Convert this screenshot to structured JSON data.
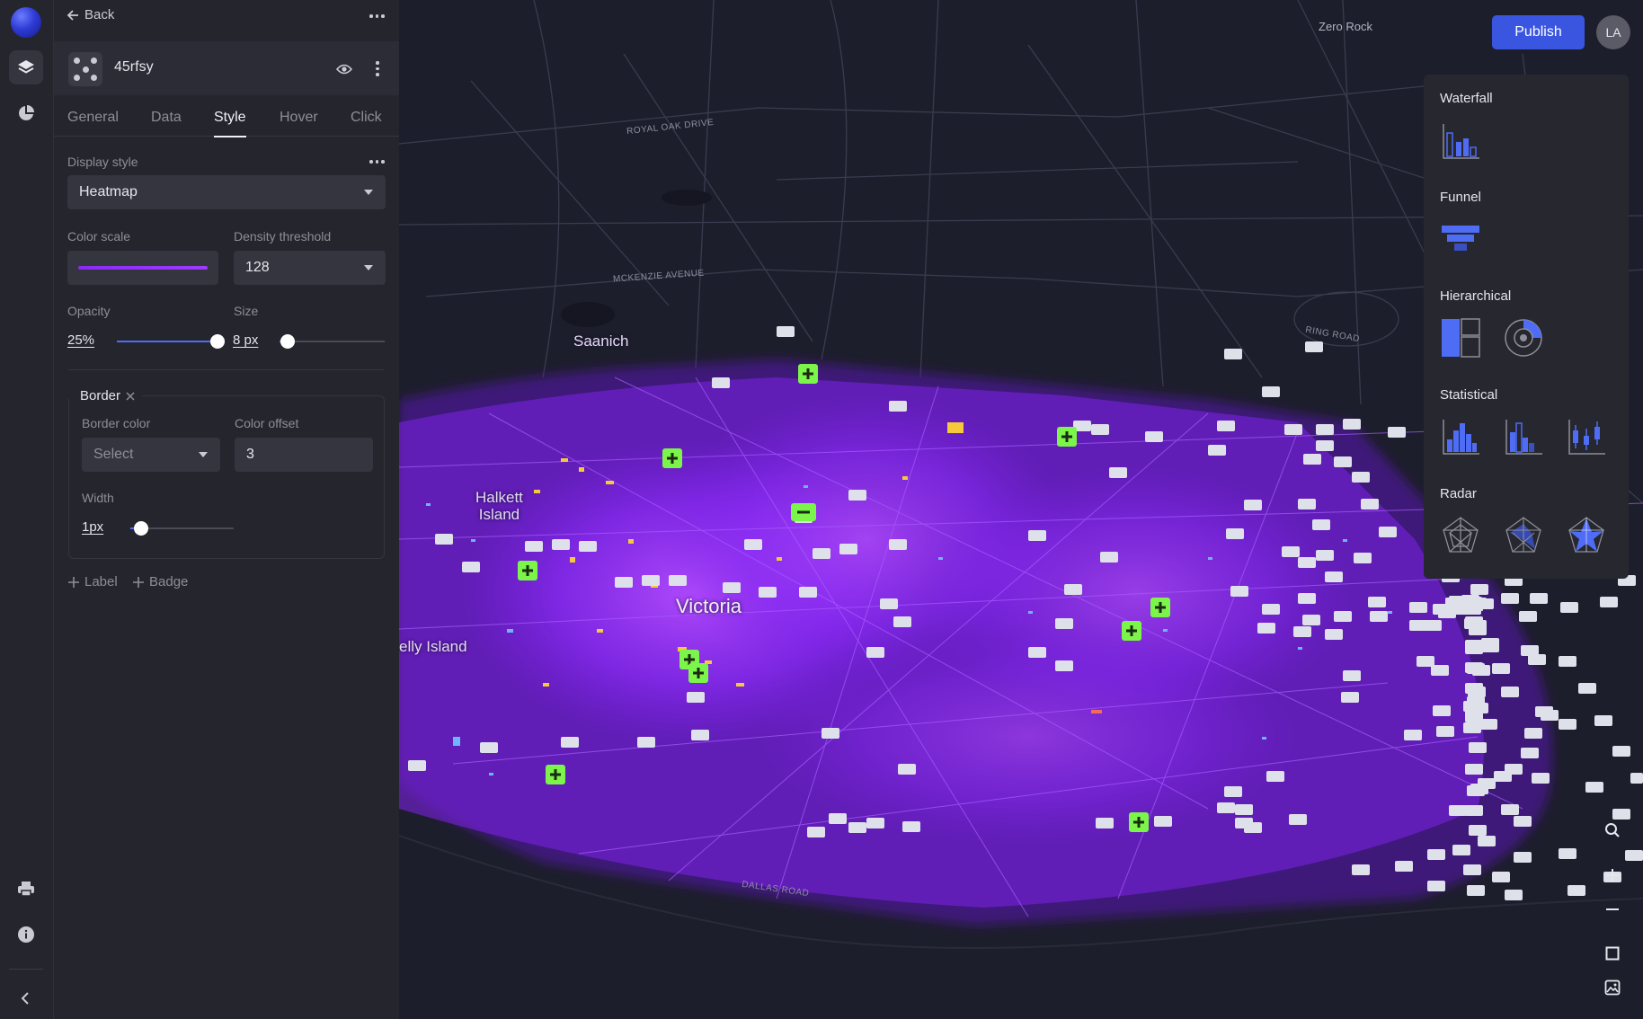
{
  "nav": {
    "back_label": "Back"
  },
  "layer": {
    "name": "45rfsy",
    "tabs": [
      "General",
      "Data",
      "Style",
      "Hover",
      "Click"
    ],
    "active_tab": "Style"
  },
  "style": {
    "display_style_label": "Display style",
    "display_style_value": "Heatmap",
    "color_scale_label": "Color scale",
    "color_scale_color": "#8a2bf5",
    "density_threshold_label": "Density threshold",
    "density_threshold_value": "128",
    "opacity_label": "Opacity",
    "opacity_value": "25%",
    "opacity_fraction": 1.0,
    "size_label": "Size",
    "size_value": "8 px",
    "size_fraction": 0.08
  },
  "border": {
    "title": "Border",
    "border_color_label": "Border color",
    "border_color_value": "Select",
    "color_offset_label": "Color offset",
    "color_offset_value": "3",
    "width_label": "Width",
    "width_value": "1px",
    "width_fraction": 0.1
  },
  "add_actions": {
    "label": "Label",
    "badge": "Badge"
  },
  "header": {
    "publish_label": "Publish",
    "avatar_initials": "LA"
  },
  "map": {
    "city": "Victoria",
    "places": [
      "Saanich",
      "Halkett\nIsland",
      "elly Island"
    ],
    "top_label": "Zero Rock",
    "streets": [
      "ROYAL OAK DRIVE",
      "MCKENZIE AVENUE",
      "RING ROAD",
      "DALLAS ROAD"
    ],
    "heat_color": "#8a2bf5",
    "hospital_color": "#7cf54a"
  },
  "chart_types": {
    "groups": [
      {
        "title": "Waterfall",
        "icons": [
          "waterfall-icon"
        ]
      },
      {
        "title": "Funnel",
        "icons": [
          "funnel-icon"
        ]
      },
      {
        "title": "Hierarchical",
        "icons": [
          "treemap-icon",
          "sunburst-icon"
        ]
      },
      {
        "title": "Statistical",
        "icons": [
          "histogram-icon",
          "distribution-icon",
          "box-plot-icon"
        ]
      },
      {
        "title": "Radar",
        "icons": [
          "radar-outline-icon",
          "radar-filled-icon",
          "radar-star-icon"
        ]
      }
    ],
    "accent": "#3a56e0"
  }
}
